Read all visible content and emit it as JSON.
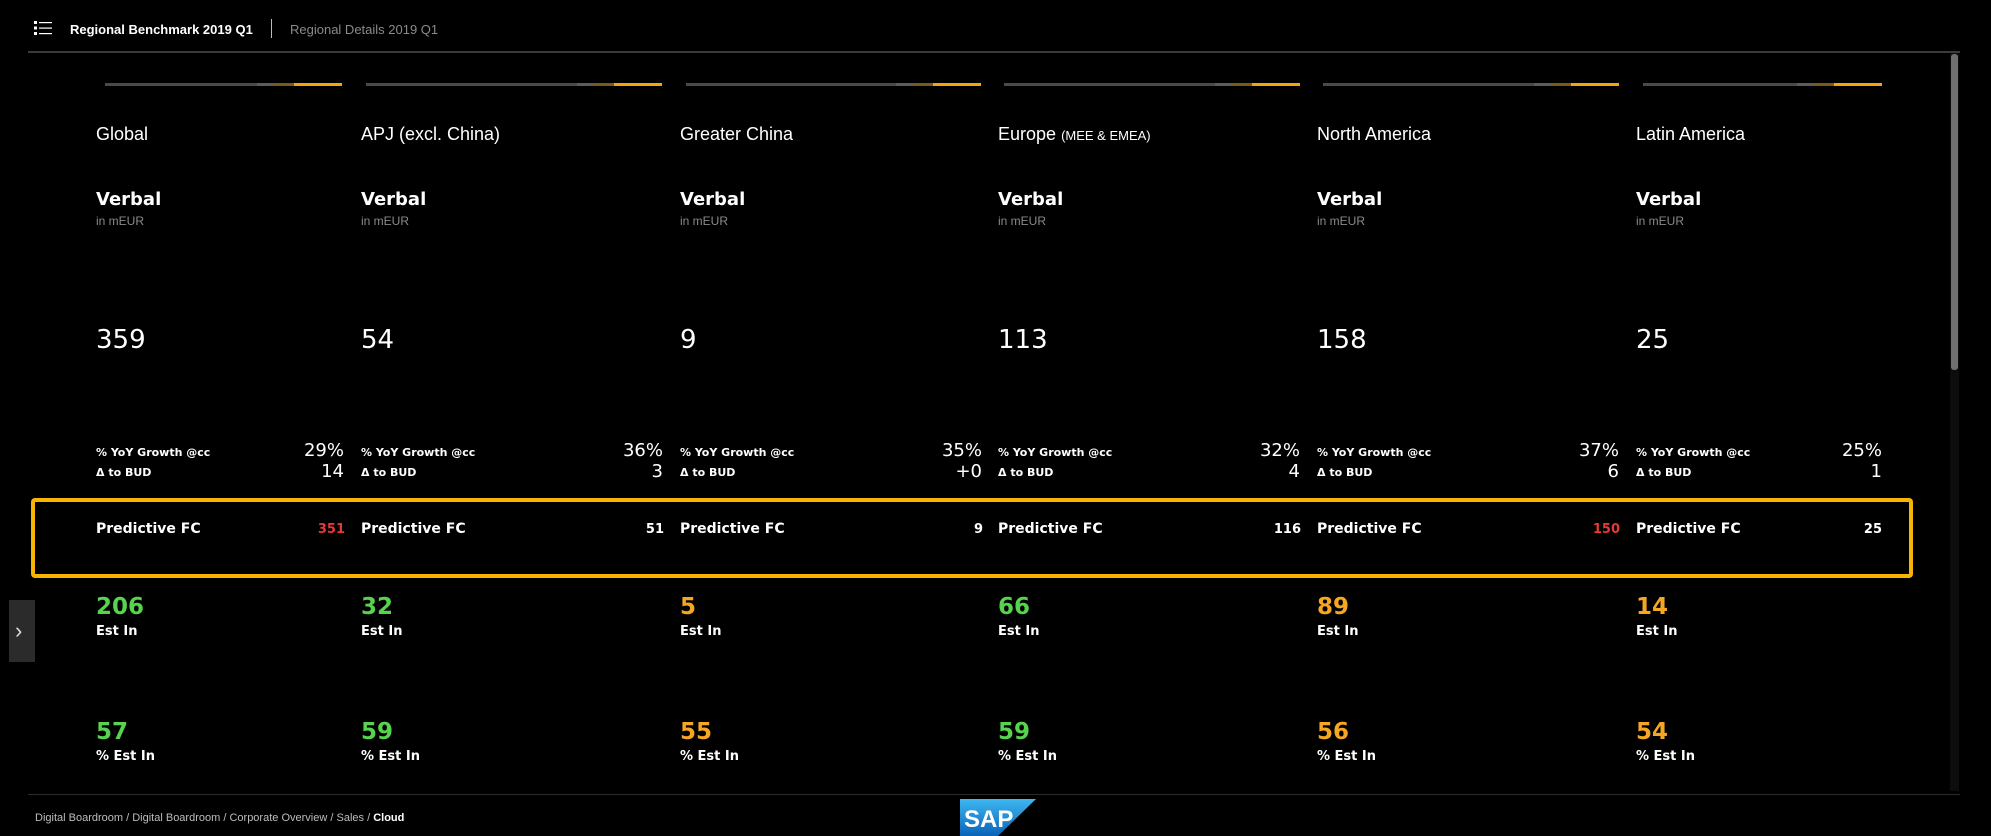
{
  "tabs": [
    {
      "label": "Regional Benchmark 2019 Q1",
      "active": true
    },
    {
      "label": "Regional Details 2019 Q1",
      "active": false
    }
  ],
  "icons": {
    "menu": "list-menu-icon",
    "expand": "chevron-right-icon",
    "logo": "sap-logo"
  },
  "colors": {
    "accent": "#f5a40f",
    "highlight": "#f7b400",
    "green": "#57d34f",
    "orange": "#f5a623",
    "red": "#e53935"
  },
  "metrics": {
    "verbal": "Verbal",
    "unit": "in mEUR",
    "yoy": "% YoY Growth @cc",
    "delta": "Δ to BUD",
    "predictive": "Predictive FC",
    "est_in": "Est In",
    "pct_est_in": "% Est In"
  },
  "regions": [
    {
      "name": "Global",
      "name_suffix": "",
      "verbal": "359",
      "yoy": "29%",
      "delta": "14",
      "pfc": "351",
      "pfc_color": "red",
      "est_in": "206",
      "est_color": "green",
      "pct_est_in": "57",
      "pct_color": "green"
    },
    {
      "name": "APJ (excl. China)",
      "name_suffix": "",
      "verbal": "54",
      "yoy": "36%",
      "delta": "3",
      "pfc": "51",
      "pfc_color": "white",
      "est_in": "32",
      "est_color": "green",
      "pct_est_in": "59",
      "pct_color": "green"
    },
    {
      "name": "Greater China",
      "name_suffix": "",
      "verbal": "9",
      "yoy": "35%",
      "delta": "+0",
      "pfc": "9",
      "pfc_color": "white",
      "est_in": "5",
      "est_color": "orange",
      "pct_est_in": "55",
      "pct_color": "orange"
    },
    {
      "name": "Europe",
      "name_suffix": "(MEE & EMEA)",
      "verbal": "113",
      "yoy": "32%",
      "delta": "4",
      "pfc": "116",
      "pfc_color": "white",
      "est_in": "66",
      "est_color": "green",
      "pct_est_in": "59",
      "pct_color": "green"
    },
    {
      "name": "North America",
      "name_suffix": "",
      "verbal": "158",
      "yoy": "37%",
      "delta": "6",
      "pfc": "150",
      "pfc_color": "red",
      "est_in": "89",
      "est_color": "orange",
      "pct_est_in": "56",
      "pct_color": "orange"
    },
    {
      "name": "Latin America",
      "name_suffix": "",
      "verbal": "25",
      "yoy": "25%",
      "delta": "1",
      "pfc": "25",
      "pfc_color": "white",
      "est_in": "14",
      "est_color": "orange",
      "pct_est_in": "54",
      "pct_color": "orange"
    }
  ],
  "breadcrumb": [
    {
      "label": "Digital Boardroom"
    },
    {
      "label": "Digital Boardroom"
    },
    {
      "label": "Corporate Overview"
    },
    {
      "label": "Sales"
    },
    {
      "label": "Cloud",
      "current": true
    }
  ],
  "breadcrumb_separator": "/",
  "logo_text": "SAP"
}
